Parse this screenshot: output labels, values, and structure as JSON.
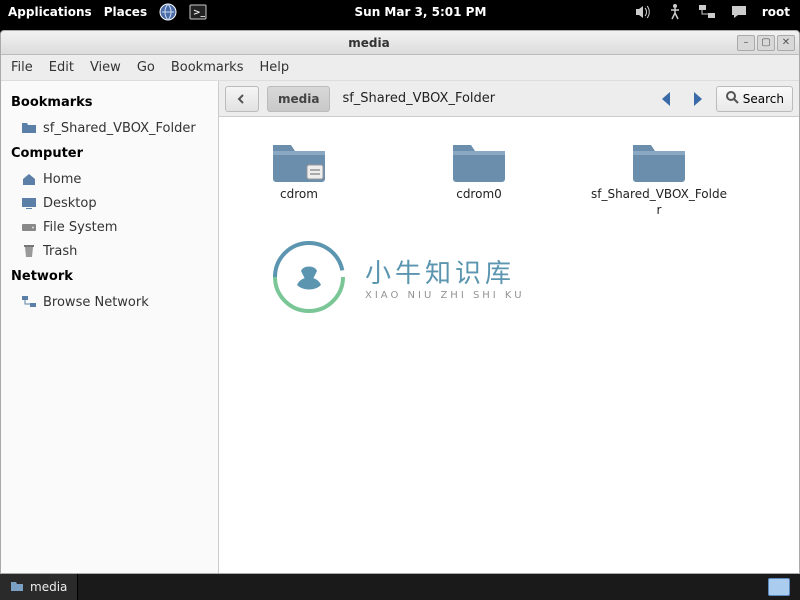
{
  "panel": {
    "applications": "Applications",
    "places": "Places",
    "clock": "Sun Mar 3, 5:01 PM",
    "user": "root"
  },
  "window": {
    "title": "media",
    "menu": {
      "file": "File",
      "edit": "Edit",
      "view": "View",
      "go": "Go",
      "bookmarks": "Bookmarks",
      "help": "Help"
    }
  },
  "sidebar": {
    "sections": {
      "bookmarks": "Bookmarks",
      "computer": "Computer",
      "network": "Network"
    },
    "bookmarks": [
      {
        "label": "sf_Shared_VBOX_Folder"
      }
    ],
    "computer": [
      {
        "label": "Home"
      },
      {
        "label": "Desktop"
      },
      {
        "label": "File System"
      },
      {
        "label": "Trash"
      }
    ],
    "network": [
      {
        "label": "Browse Network"
      }
    ]
  },
  "toolbar": {
    "path_current": "media",
    "path_next": "sf_Shared_VBOX_Folder",
    "search": "Search"
  },
  "folders": [
    {
      "name": "cdrom",
      "badge": "unmount"
    },
    {
      "name": "cdrom0",
      "badge": null
    },
    {
      "name": "sf_Shared_VBOX_Folder",
      "badge": null
    }
  ],
  "watermark": {
    "title": "小牛知识库",
    "subtitle": "XIAO NIU ZHI SHI KU"
  },
  "taskbar": {
    "item": "media"
  }
}
